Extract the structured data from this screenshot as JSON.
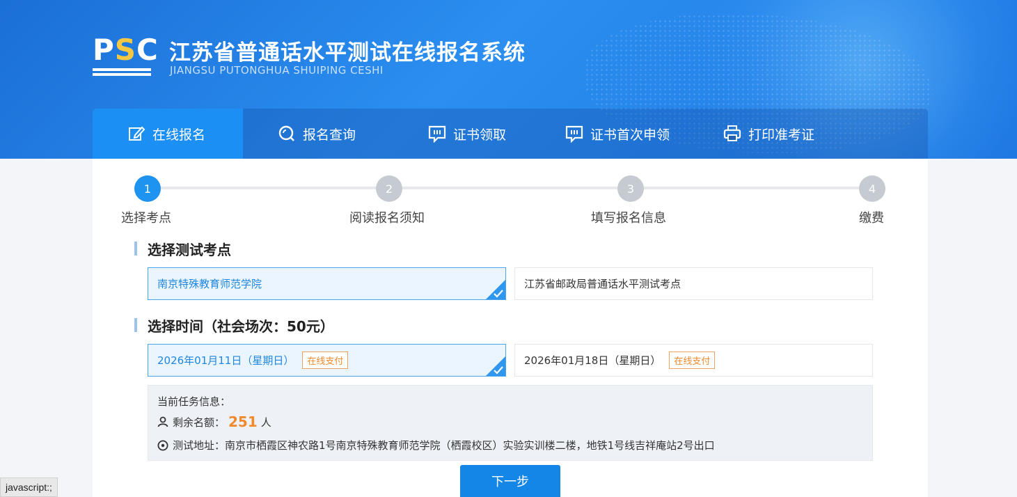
{
  "header": {
    "logo_p": "P",
    "logo_s": "S",
    "logo_c": "C",
    "title": "江苏省普通话水平测试在线报名系统",
    "subtitle": "JIANGSU PUTONGHUA SHUIPING CESHI"
  },
  "nav": {
    "items": [
      {
        "label": "在线报名",
        "icon": "edit-icon"
      },
      {
        "label": "报名查询",
        "icon": "search-icon"
      },
      {
        "label": "证书领取",
        "icon": "certificate-icon"
      },
      {
        "label": "证书首次申领",
        "icon": "certificate-icon"
      },
      {
        "label": "打印准考证",
        "icon": "printer-icon"
      }
    ]
  },
  "steps": [
    {
      "num": "1",
      "label": "选择考点"
    },
    {
      "num": "2",
      "label": "阅读报名须知"
    },
    {
      "num": "3",
      "label": "填写报名信息"
    },
    {
      "num": "4",
      "label": "缴费"
    }
  ],
  "sites": {
    "title": "选择测试考点",
    "options": [
      "南京特殊教育师范学院",
      "江苏省邮政局普通话水平测试考点"
    ]
  },
  "times": {
    "title": "选择时间（社会场次：50元）",
    "options": [
      {
        "date": "2026年01月11日（星期日）",
        "badge": "在线支付"
      },
      {
        "date": "2026年01月18日（星期日）",
        "badge": "在线支付"
      }
    ]
  },
  "info": {
    "heading": "当前任务信息：",
    "remaining_label": "剩余名额：",
    "remaining_value": "251",
    "remaining_unit": "人",
    "address_label": "测试地址：",
    "address": "南京市栖霞区神农路1号南京特殊教育师范学院（栖霞校区）实验实训楼二楼，地铁1号线吉祥庵站2号出口"
  },
  "next_label": "下一步",
  "status_text": "javascript:;",
  "colors": {
    "primary": "#1e93f0",
    "accent": "#f08a2c"
  }
}
